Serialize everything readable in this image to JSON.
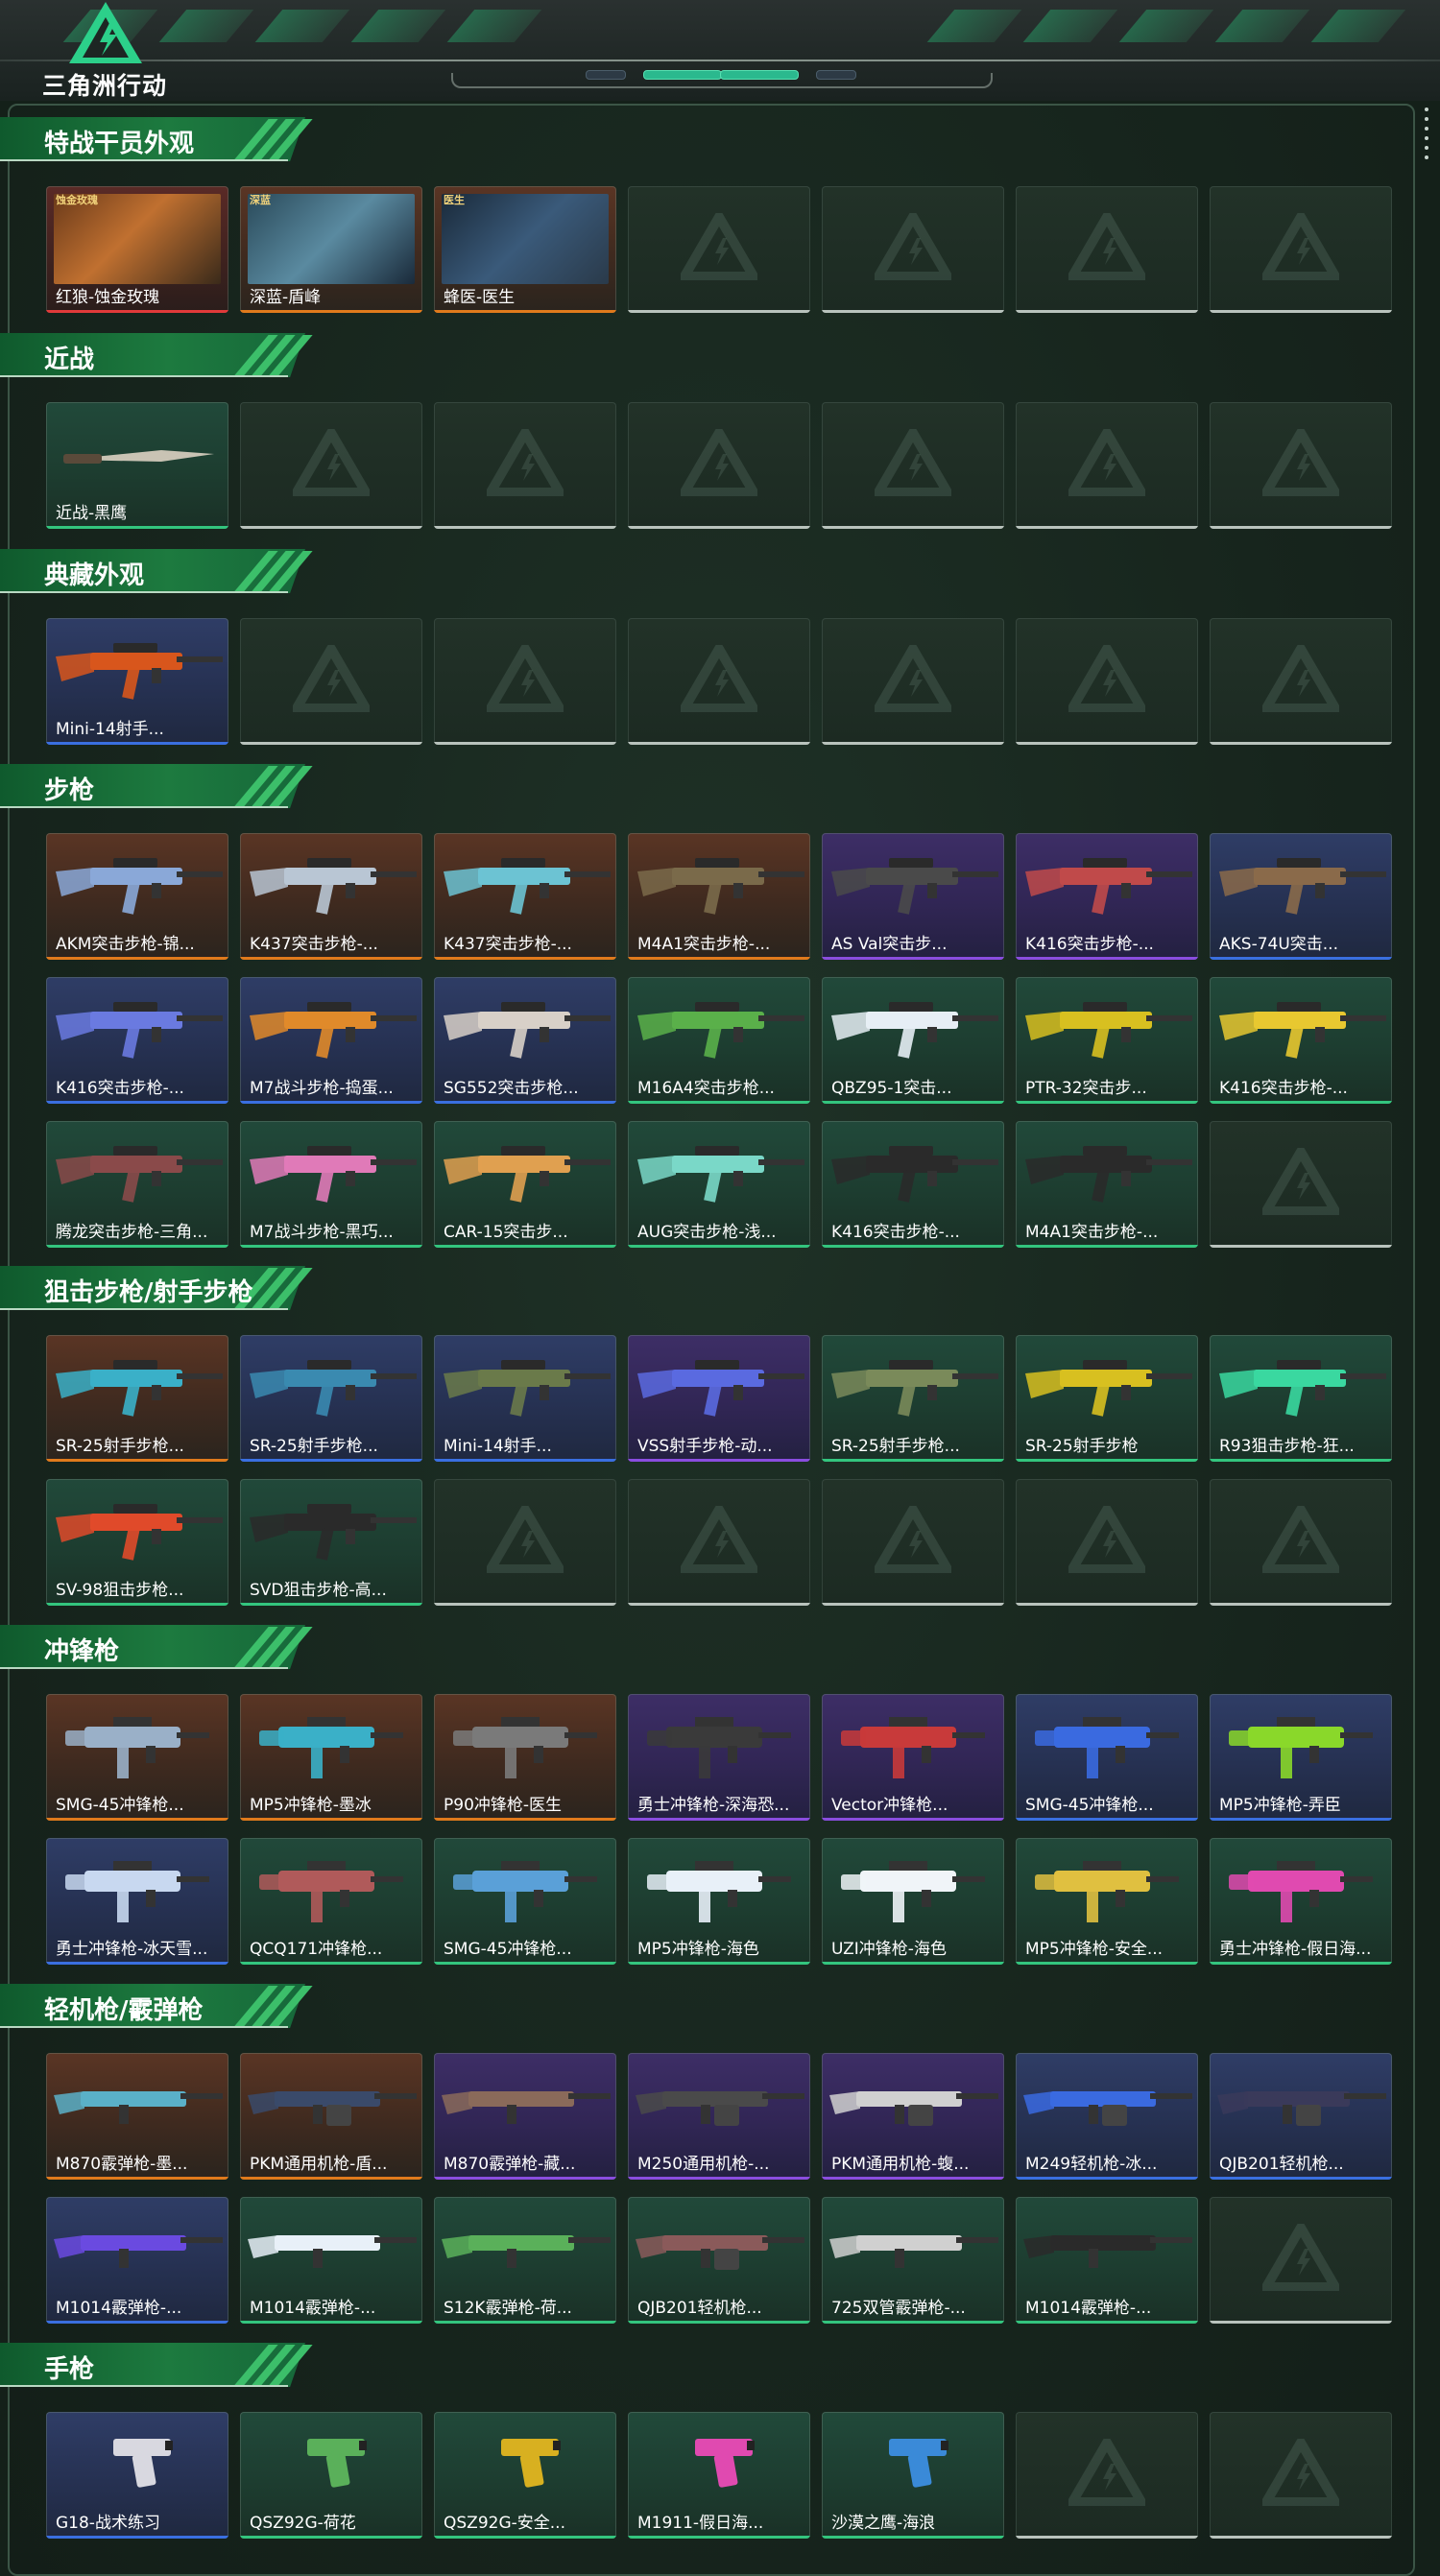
{
  "app": {
    "logo_text": "三角洲行动"
  },
  "colors": {
    "accent": "#2bb98e",
    "banner": "#1d7a3f",
    "rarity_orange": "#e07a1c",
    "rarity_blue": "#3a6fe0",
    "rarity_purple": "#8a4ddf",
    "rarity_green": "#33c57e",
    "rarity_red": "#e03a3a",
    "rarity_empty": "#b9c3bd"
  },
  "sections": [
    {
      "title": "特战干员外观",
      "rows": [
        [
          {
            "label": "红狼-蚀金玫瑰",
            "rarity": "red",
            "icon": "operator-portrait",
            "tag": "蚀金玫瑰"
          },
          {
            "label": "深蓝-盾峰",
            "rarity": "orange",
            "icon": "operator-portrait",
            "tag": "深蓝"
          },
          {
            "label": "蜂医-医生",
            "rarity": "orange",
            "icon": "operator-portrait",
            "tag": "医生"
          },
          {
            "empty": true
          },
          {
            "empty": true
          },
          {
            "empty": true
          },
          {
            "empty": true
          }
        ]
      ]
    },
    {
      "title": "近战",
      "rows": [
        [
          {
            "label": "近战-黑鹰",
            "rarity": "green",
            "icon": "knife-icon"
          },
          {
            "empty": true
          },
          {
            "empty": true
          },
          {
            "empty": true
          },
          {
            "empty": true
          },
          {
            "empty": true
          },
          {
            "empty": true
          }
        ]
      ]
    },
    {
      "title": "典藏外观",
      "rows": [
        [
          {
            "label": "Mini-14射手...",
            "rarity": "blue",
            "icon": "rifle-icon",
            "gun": "#d8561c"
          },
          {
            "empty": true
          },
          {
            "empty": true
          },
          {
            "empty": true
          },
          {
            "empty": true
          },
          {
            "empty": true
          },
          {
            "empty": true
          }
        ]
      ]
    },
    {
      "title": "步枪",
      "rows": [
        [
          {
            "label": "AKM突击步枪-锦...",
            "rarity": "orange",
            "icon": "rifle-icon",
            "gun": "#8aa8d8"
          },
          {
            "label": "K437突击步枪-...",
            "rarity": "orange",
            "icon": "rifle-icon",
            "gun": "#b9c6d4"
          },
          {
            "label": "K437突击步枪-...",
            "rarity": "orange",
            "icon": "rifle-icon",
            "gun": "#6cc3d3"
          },
          {
            "label": "M4A1突击步枪-...",
            "rarity": "orange",
            "icon": "rifle-icon",
            "gun": "#7a6a4a"
          },
          {
            "label": "AS Val突击步...",
            "rarity": "purple",
            "icon": "rifle-icon",
            "gun": "#4a4a4a"
          },
          {
            "label": "K416突击步枪-...",
            "rarity": "purple",
            "icon": "rifle-icon",
            "gun": "#c04a4a"
          },
          {
            "label": "AKS-74U突击...",
            "rarity": "blue",
            "icon": "rifle-icon",
            "gun": "#8a6a4a"
          }
        ],
        [
          {
            "label": "K416突击步枪-...",
            "rarity": "blue",
            "icon": "rifle-icon",
            "gun": "#6a7ae0"
          },
          {
            "label": "M7战斗步枪-捣蛋...",
            "rarity": "blue",
            "icon": "rifle-icon",
            "gun": "#e08a2a"
          },
          {
            "label": "SG552突击步枪...",
            "rarity": "blue",
            "icon": "rifle-icon",
            "gun": "#d8d0c8"
          },
          {
            "label": "M16A4突击步枪...",
            "rarity": "green",
            "icon": "rifle-icon",
            "gun": "#5ab04a"
          },
          {
            "label": "QBZ95-1突击...",
            "rarity": "green",
            "icon": "rifle-icon",
            "gun": "#e6eef5"
          },
          {
            "label": "PTR-32突击步...",
            "rarity": "green",
            "icon": "rifle-icon",
            "gun": "#d8c020"
          },
          {
            "label": "K416突击步枪-...",
            "rarity": "green",
            "icon": "rifle-icon",
            "gun": "#e8c830"
          }
        ],
        [
          {
            "label": "腾龙突击步枪-三角...",
            "rarity": "green",
            "icon": "rifle-icon",
            "gun": "#8a4a4a"
          },
          {
            "label": "M7战斗步枪-黑巧...",
            "rarity": "green",
            "icon": "rifle-icon",
            "gun": "#e07ab8"
          },
          {
            "label": "CAR-15突击步...",
            "rarity": "green",
            "icon": "rifle-icon",
            "gun": "#e0a050"
          },
          {
            "label": "AUG突击步枪-浅...",
            "rarity": "green",
            "icon": "rifle-icon",
            "gun": "#7ad8c8"
          },
          {
            "label": "K416突击步枪-...",
            "rarity": "green",
            "icon": "rifle-icon",
            "gun": "#2a2a2a"
          },
          {
            "label": "M4A1突击步枪-...",
            "rarity": "green",
            "icon": "rifle-icon",
            "gun": "#2a2a2a"
          },
          {
            "empty": true
          }
        ]
      ]
    },
    {
      "title": "狙击步枪/射手步枪",
      "rows": [
        [
          {
            "label": "SR-25射手步枪...",
            "rarity": "orange",
            "icon": "rifle-icon",
            "gun": "#3ab0c8"
          },
          {
            "label": "SR-25射手步枪...",
            "rarity": "blue",
            "icon": "rifle-icon",
            "gun": "#3a8ab0"
          },
          {
            "label": "Mini-14射手...",
            "rarity": "blue",
            "icon": "rifle-icon",
            "gun": "#6a7a4a"
          },
          {
            "label": "VSS射手步枪-动...",
            "rarity": "purple",
            "icon": "rifle-icon",
            "gun": "#5a6ae0"
          },
          {
            "label": "SR-25射手步枪...",
            "rarity": "green",
            "icon": "rifle-icon",
            "gun": "#7a8a5a"
          },
          {
            "label": "SR-25射手步枪",
            "rarity": "green",
            "icon": "rifle-icon",
            "gun": "#d8c020"
          },
          {
            "label": "R93狙击步枪-狂...",
            "rarity": "green",
            "icon": "rifle-icon",
            "gun": "#3ad8a0"
          }
        ],
        [
          {
            "label": "SV-98狙击步枪...",
            "rarity": "green",
            "icon": "rifle-icon",
            "gun": "#e04a2a"
          },
          {
            "label": "SVD狙击步枪-高...",
            "rarity": "green",
            "icon": "rifle-icon",
            "gun": "#2a2a2a"
          },
          {
            "empty": true
          },
          {
            "empty": true
          },
          {
            "empty": true
          },
          {
            "empty": true
          },
          {
            "empty": true
          }
        ]
      ]
    },
    {
      "title": "冲锋枪",
      "rows": [
        [
          {
            "label": "SMG-45冲锋枪...",
            "rarity": "orange",
            "icon": "smg-icon",
            "gun": "#9ab0c8"
          },
          {
            "label": "MP5冲锋枪-墨冰",
            "rarity": "orange",
            "icon": "smg-icon",
            "gun": "#3ab0c8"
          },
          {
            "label": "P90冲锋枪-医生",
            "rarity": "orange",
            "icon": "smg-icon",
            "gun": "#7a7a7a"
          },
          {
            "label": "勇士冲锋枪-深海恐...",
            "rarity": "purple",
            "icon": "smg-icon",
            "gun": "#3a3a3a"
          },
          {
            "label": "Vector冲锋枪...",
            "rarity": "purple",
            "icon": "smg-icon",
            "gun": "#c83a3a"
          },
          {
            "label": "SMG-45冲锋枪...",
            "rarity": "blue",
            "icon": "smg-icon",
            "gun": "#3a6ae0"
          },
          {
            "label": "MP5冲锋枪-弄臣",
            "rarity": "blue",
            "icon": "smg-icon",
            "gun": "#8ad82a"
          }
        ],
        [
          {
            "label": "勇士冲锋枪-冰天雪...",
            "rarity": "blue",
            "icon": "smg-icon",
            "gun": "#c8d8f0"
          },
          {
            "label": "QCQ171冲锋枪...",
            "rarity": "green",
            "icon": "smg-icon",
            "gun": "#b05a5a"
          },
          {
            "label": "SMG-45冲锋枪...",
            "rarity": "green",
            "icon": "smg-icon",
            "gun": "#5aa0d8"
          },
          {
            "label": "MP5冲锋枪-海色",
            "rarity": "green",
            "icon": "smg-icon",
            "gun": "#e8f0f8"
          },
          {
            "label": "UZI冲锋枪-海色",
            "rarity": "green",
            "icon": "smg-icon",
            "gun": "#f0f4f8"
          },
          {
            "label": "MP5冲锋枪-安全...",
            "rarity": "green",
            "icon": "smg-icon",
            "gun": "#e0c040"
          },
          {
            "label": "勇士冲锋枪-假日海...",
            "rarity": "green",
            "icon": "smg-icon",
            "gun": "#e04ab0"
          }
        ]
      ]
    },
    {
      "title": "轻机枪/霰弹枪",
      "rows": [
        [
          {
            "label": "M870霰弹枪-墨...",
            "rarity": "orange",
            "icon": "shotgun-icon",
            "gun": "#5ab0c8"
          },
          {
            "label": "PKM通用机枪-盾...",
            "rarity": "orange",
            "icon": "machinegun-icon",
            "gun": "#3a4a6a"
          },
          {
            "label": "M870霰弹枪-藏...",
            "rarity": "purple",
            "icon": "shotgun-icon",
            "gun": "#8a6a5a"
          },
          {
            "label": "M250通用机枪-...",
            "rarity": "purple",
            "icon": "machinegun-icon",
            "gun": "#4a4a4a"
          },
          {
            "label": "PKM通用机枪-蝮...",
            "rarity": "purple",
            "icon": "machinegun-icon",
            "gun": "#d0d0d0"
          },
          {
            "label": "M249轻机枪-冰...",
            "rarity": "blue",
            "icon": "machinegun-icon",
            "gun": "#3a6ae0"
          },
          {
            "label": "QJB201轻机枪...",
            "rarity": "blue",
            "icon": "machinegun-icon",
            "gun": "#3a3a5a"
          }
        ],
        [
          {
            "label": "M1014霰弹枪-...",
            "rarity": "blue",
            "icon": "shotgun-icon",
            "gun": "#6a4ae0"
          },
          {
            "label": "M1014霰弹枪-...",
            "rarity": "green",
            "icon": "shotgun-icon",
            "gun": "#e8f0f8"
          },
          {
            "label": "S12K霰弹枪-荷...",
            "rarity": "green",
            "icon": "shotgun-icon",
            "gun": "#5ab05a"
          },
          {
            "label": "QJB201轻机枪...",
            "rarity": "green",
            "icon": "machinegun-icon",
            "gun": "#8a5a5a"
          },
          {
            "label": "725双管霰弹枪-...",
            "rarity": "green",
            "icon": "shotgun-icon",
            "gun": "#d0d0d0"
          },
          {
            "label": "M1014霰弹枪-...",
            "rarity": "green",
            "icon": "shotgun-icon",
            "gun": "#2a2a2a"
          },
          {
            "empty": true
          }
        ]
      ]
    },
    {
      "title": "手枪",
      "rows": [
        [
          {
            "label": "G18-战术练习",
            "rarity": "blue",
            "icon": "pistol-icon",
            "gun": "#d8d8e0"
          },
          {
            "label": "QSZ92G-荷花",
            "rarity": "green",
            "icon": "pistol-icon",
            "gun": "#5ab05a"
          },
          {
            "label": "QSZ92G-安全...",
            "rarity": "green",
            "icon": "pistol-icon",
            "gun": "#d8b020"
          },
          {
            "label": "M1911-假日海...",
            "rarity": "green",
            "icon": "pistol-icon",
            "gun": "#e04ab0"
          },
          {
            "label": "沙漠之鹰-海浪",
            "rarity": "green",
            "icon": "pistol-icon",
            "gun": "#3a8ad8"
          },
          {
            "empty": true
          },
          {
            "empty": true
          }
        ]
      ]
    }
  ]
}
